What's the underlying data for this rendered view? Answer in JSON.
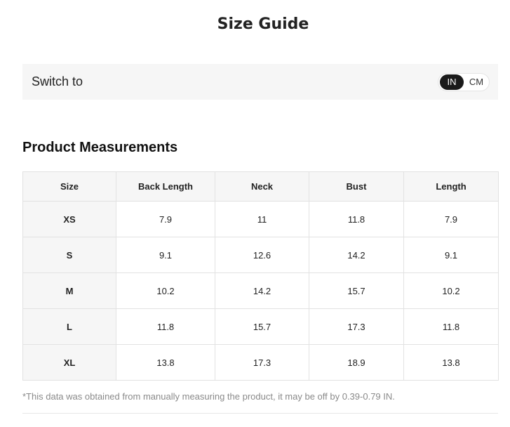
{
  "title": "Size Guide",
  "unit_switch": {
    "label": "Switch to",
    "options": [
      "IN",
      "CM"
    ],
    "selected": "IN"
  },
  "section_title": "Product Measurements",
  "table": {
    "headers": [
      "Size",
      "Back Length",
      "Neck",
      "Bust",
      "Length"
    ],
    "rows": [
      [
        "XS",
        "7.9",
        "11",
        "11.8",
        "7.9"
      ],
      [
        "S",
        "9.1",
        "12.6",
        "14.2",
        "9.1"
      ],
      [
        "M",
        "10.2",
        "14.2",
        "15.7",
        "10.2"
      ],
      [
        "L",
        "11.8",
        "15.7",
        "17.3",
        "11.8"
      ],
      [
        "XL",
        "13.8",
        "17.3",
        "18.9",
        "13.8"
      ]
    ]
  },
  "note": "*This data was obtained from manually measuring the product, it may be off by 0.39-0.79 IN.",
  "colors": {
    "accent": "#1a1a1a",
    "panel_bg": "#f6f6f6",
    "border": "#e2e2e2",
    "note_text": "#8a8a8a"
  }
}
